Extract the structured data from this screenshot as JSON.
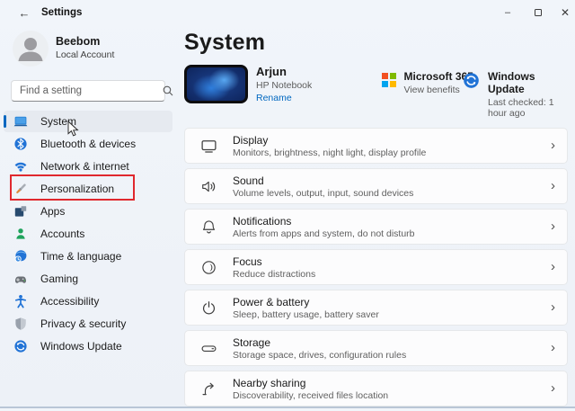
{
  "titlebar": {
    "back_glyph": "←",
    "title": "Settings",
    "minimize_glyph": "–",
    "close_glyph": "✕"
  },
  "sidebar": {
    "user": {
      "name": "Beebom",
      "subtitle": "Local Account"
    },
    "search": {
      "placeholder": "Find a setting",
      "icon": "search-icon"
    },
    "items": [
      {
        "label": "System",
        "icon": "laptop-icon",
        "selected": true
      },
      {
        "label": "Bluetooth & devices",
        "icon": "bluetooth-icon"
      },
      {
        "label": "Network & internet",
        "icon": "wifi-icon"
      },
      {
        "label": "Personalization",
        "icon": "paintbrush-icon",
        "annotated": true
      },
      {
        "label": "Apps",
        "icon": "apps-icon"
      },
      {
        "label": "Accounts",
        "icon": "person-icon"
      },
      {
        "label": "Time & language",
        "icon": "clock-globe-icon"
      },
      {
        "label": "Gaming",
        "icon": "gamepad-icon"
      },
      {
        "label": "Accessibility",
        "icon": "accessibility-icon"
      },
      {
        "label": "Privacy & security",
        "icon": "shield-icon"
      },
      {
        "label": "Windows Update",
        "icon": "update-icon"
      }
    ]
  },
  "main": {
    "page_title": "System",
    "device": {
      "name": "Arjun",
      "model": "HP Notebook",
      "rename_link": "Rename"
    },
    "microsoft365": {
      "title": "Microsoft 365",
      "subtitle": "View benefits",
      "icon": "microsoft-logo"
    },
    "windows_update": {
      "title": "Windows Update",
      "subtitle": "Last checked: 1 hour ago",
      "icon": "update-icon"
    },
    "chevron_glyph": "›",
    "rows": [
      {
        "title": "Display",
        "subtitle": "Monitors, brightness, night light, display profile",
        "icon": "display-icon"
      },
      {
        "title": "Sound",
        "subtitle": "Volume levels, output, input, sound devices",
        "icon": "speaker-icon"
      },
      {
        "title": "Notifications",
        "subtitle": "Alerts from apps and system, do not disturb",
        "icon": "bell-icon"
      },
      {
        "title": "Focus",
        "subtitle": "Reduce distractions",
        "icon": "focus-icon"
      },
      {
        "title": "Power & battery",
        "subtitle": "Sleep, battery usage, battery saver",
        "icon": "power-icon"
      },
      {
        "title": "Storage",
        "subtitle": "Storage space, drives, configuration rules",
        "icon": "drive-icon"
      },
      {
        "title": "Nearby sharing",
        "subtitle": "Discoverability, received files location",
        "icon": "share-icon"
      }
    ]
  },
  "colors": {
    "accent": "#0067c0",
    "annotation_red": "#e0282e",
    "link": "#0067c0",
    "ms_red": "#f25022",
    "ms_green": "#7fba00",
    "ms_blue": "#00a4ef",
    "ms_yellow": "#ffb900"
  }
}
